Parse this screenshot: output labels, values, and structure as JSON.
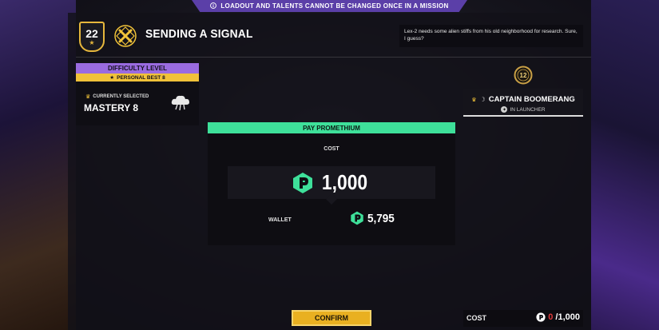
{
  "banner": {
    "warning_text": "LOADOUT AND TALENTS CANNOT BE CHANGED ONCE IN A MISSION",
    "icon": "info-icon"
  },
  "header": {
    "level": "22",
    "mission_icon": "signal-x-icon",
    "mission_title": "SENDING A SIGNAL",
    "description": "Lex-2 needs some alien stiffs from his old neighborhood for research. Sure, I guess?"
  },
  "difficulty": {
    "heading": "DIFFICULTY LEVEL",
    "personal_best": "PERSONAL BEST 8",
    "current_label": "CURRENTLY SELECTED",
    "value": "MASTERY 8",
    "icon": "mastery-cloud-icon"
  },
  "character": {
    "emblem_level": "12",
    "name": "CAPTAIN BOOMERANG",
    "status": "IN LAUNCHER"
  },
  "payment": {
    "heading": "PAY PROMETHIUM",
    "cost_label": "COST",
    "cost_amount": "1,000",
    "wallet_label": "WALLET",
    "wallet_amount": "5,795",
    "currency_icon": "promethium-icon"
  },
  "actions": {
    "confirm_label": "CONFIRM"
  },
  "cost_bar": {
    "label": "COST",
    "have": "0",
    "required": "/1,000"
  },
  "colors": {
    "accent_purple": "#9a6be0",
    "accent_gold": "#f0c239",
    "promethium_green": "#3ee09a",
    "insufficient_red": "#e23a3a"
  }
}
